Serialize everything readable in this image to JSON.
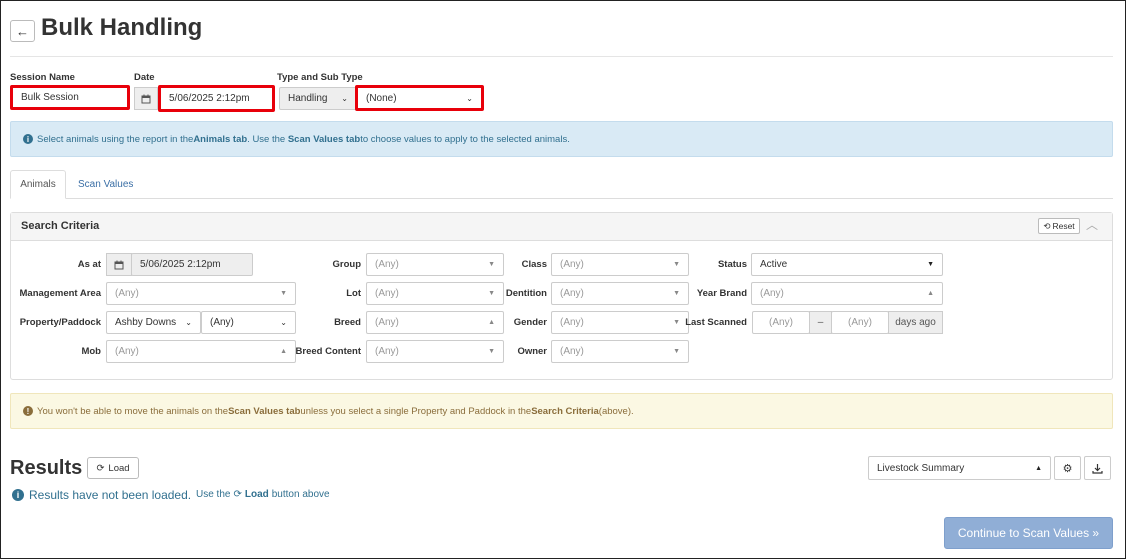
{
  "header": {
    "title": "Bulk Handling",
    "back_icon": "←"
  },
  "session": {
    "name_label": "Session Name",
    "name_value": "Bulk Session",
    "date_label": "Date",
    "date_value": "5/06/2025 2:12pm",
    "type_label": "Type and Sub Type",
    "type_value": "Handling",
    "subtype_value": "(None)"
  },
  "info": {
    "text_1": "Select animals using the report in the ",
    "bold_1": "Animals tab",
    "text_2": " . Use the ",
    "bold_2": "Scan Values tab",
    "text_3": " to choose values to apply to the selected animals."
  },
  "tabs": [
    {
      "label": "Animals"
    },
    {
      "label": "Scan Values"
    }
  ],
  "search": {
    "title": "Search Criteria",
    "reset_label": "Reset",
    "any": "(Any)",
    "as_at_label": "As at",
    "as_at_value": "5/06/2025 2:12pm",
    "management_area_label": "Management Area",
    "property_paddock_label": "Property/Paddock",
    "property_value": "Ashby Downs",
    "mob_label": "Mob",
    "group_label": "Group",
    "lot_label": "Lot",
    "breed_label": "Breed",
    "breed_content_label": "Breed Content",
    "class_label": "Class",
    "dentition_label": "Dentition",
    "gender_label": "Gender",
    "owner_label": "Owner",
    "status_label": "Status",
    "status_value": "Active",
    "year_brand_label": "Year Brand",
    "last_scanned_label": "Last Scanned",
    "last_scanned_sep": "–",
    "days_ago": "days ago"
  },
  "warning": {
    "text_1": "You won't be able to move the animals on the ",
    "bold_1": "Scan Values tab",
    "text_2": " unless you select a single Property and Paddock in the ",
    "bold_2": "Search Criteria",
    "text_3": " (above)."
  },
  "results": {
    "title": "Results",
    "load_label": "Load",
    "not_loaded": "Results have not been loaded.",
    "use_the": "Use the",
    "load_inline": "Load",
    "button_above": "button above",
    "report_select": "Livestock Summary",
    "continue_label": "Continue to Scan Values »"
  },
  "colors": {
    "highlight": "#e8000a",
    "info_bg": "#d9eaf5",
    "warn_bg": "#fbf8e3",
    "primary_disabled": "#90aed6"
  }
}
